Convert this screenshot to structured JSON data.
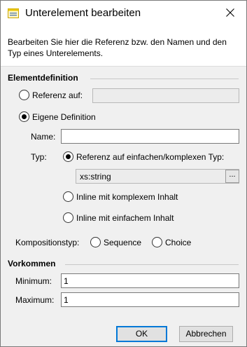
{
  "window": {
    "title": "Unterelement bearbeiten",
    "title_icon": "dialog-window-icon",
    "close_icon": "close-icon"
  },
  "description": "Bearbeiten Sie hier die Referenz bzw. den Namen und den Typ eines Unterelements.",
  "element_definition": {
    "title": "Elementdefinition",
    "reference_option": {
      "label": "Referenz auf:",
      "checked": false,
      "value": ""
    },
    "own_definition_option": {
      "label": "Eigene Definition",
      "checked": true
    },
    "name_label": "Name:",
    "name_value": "",
    "type_label": "Typ:",
    "type_options": [
      {
        "label": "Referenz auf einfachen/komplexen Typ:",
        "checked": true
      },
      {
        "label": "Inline mit komplexem Inhalt",
        "checked": false
      },
      {
        "label": "Inline mit einfachem Inhalt",
        "checked": false
      }
    ],
    "type_value": "xs:string",
    "browse_label": "..."
  },
  "composition": {
    "label": "Kompositionstyp:",
    "options": [
      {
        "label": "Sequence",
        "checked": false
      },
      {
        "label": "Choice",
        "checked": false
      }
    ]
  },
  "occurrence": {
    "title": "Vorkommen",
    "minimum_label": "Minimum:",
    "minimum_value": "1",
    "maximum_label": "Maximum:",
    "maximum_value": "1"
  },
  "buttons": {
    "ok": "OK",
    "cancel": "Abbrechen"
  },
  "colors": {
    "accent": "#0078d7",
    "dialog_bg": "#f0f0f0"
  }
}
